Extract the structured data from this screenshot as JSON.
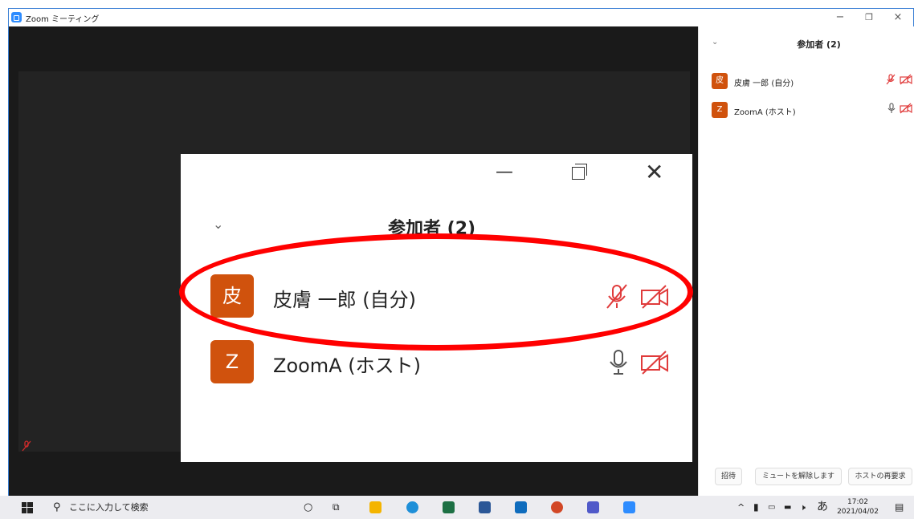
{
  "window": {
    "title": "Zoom ミーティング",
    "minimize": "−",
    "restore": "❐",
    "close": "×"
  },
  "meeting": {
    "tile_mute_icon": "mic-off-icon"
  },
  "panel": {
    "title": "参加者 (2)",
    "participants": [
      {
        "avatar": "皮",
        "name": "皮膚 一郎 (自分)",
        "mic": "muted",
        "video": "off"
      },
      {
        "avatar": "Z",
        "name": "ZoomA (ホスト)",
        "mic": "on",
        "video": "off"
      }
    ],
    "footer": {
      "invite": "招待",
      "unmute": "ミュートを解除します",
      "reclaim_host": "ホストの再要求"
    }
  },
  "zoomed": {
    "title": "参加者 (2)",
    "participants": [
      {
        "avatar": "皮",
        "name": "皮膚 一郎 (自分)"
      },
      {
        "avatar": "Z",
        "name": "ZoomA (ホスト)"
      }
    ]
  },
  "taskbar": {
    "search_placeholder": "ここに入力して検索",
    "ime": "あ",
    "time": "17:02",
    "date": "2021/04/02",
    "apps": [
      "cortana-icon",
      "taskview-icon",
      "file-explorer-icon",
      "edge-icon",
      "excel-icon",
      "word-icon",
      "outlook-icon",
      "powerpoint-icon",
      "teams-icon",
      "zoom-icon"
    ]
  },
  "colors": {
    "avatar": "#d0520d",
    "muted": "#e03b3b",
    "highlight": "#ff0000",
    "zoom_blue": "#2d8cff"
  }
}
